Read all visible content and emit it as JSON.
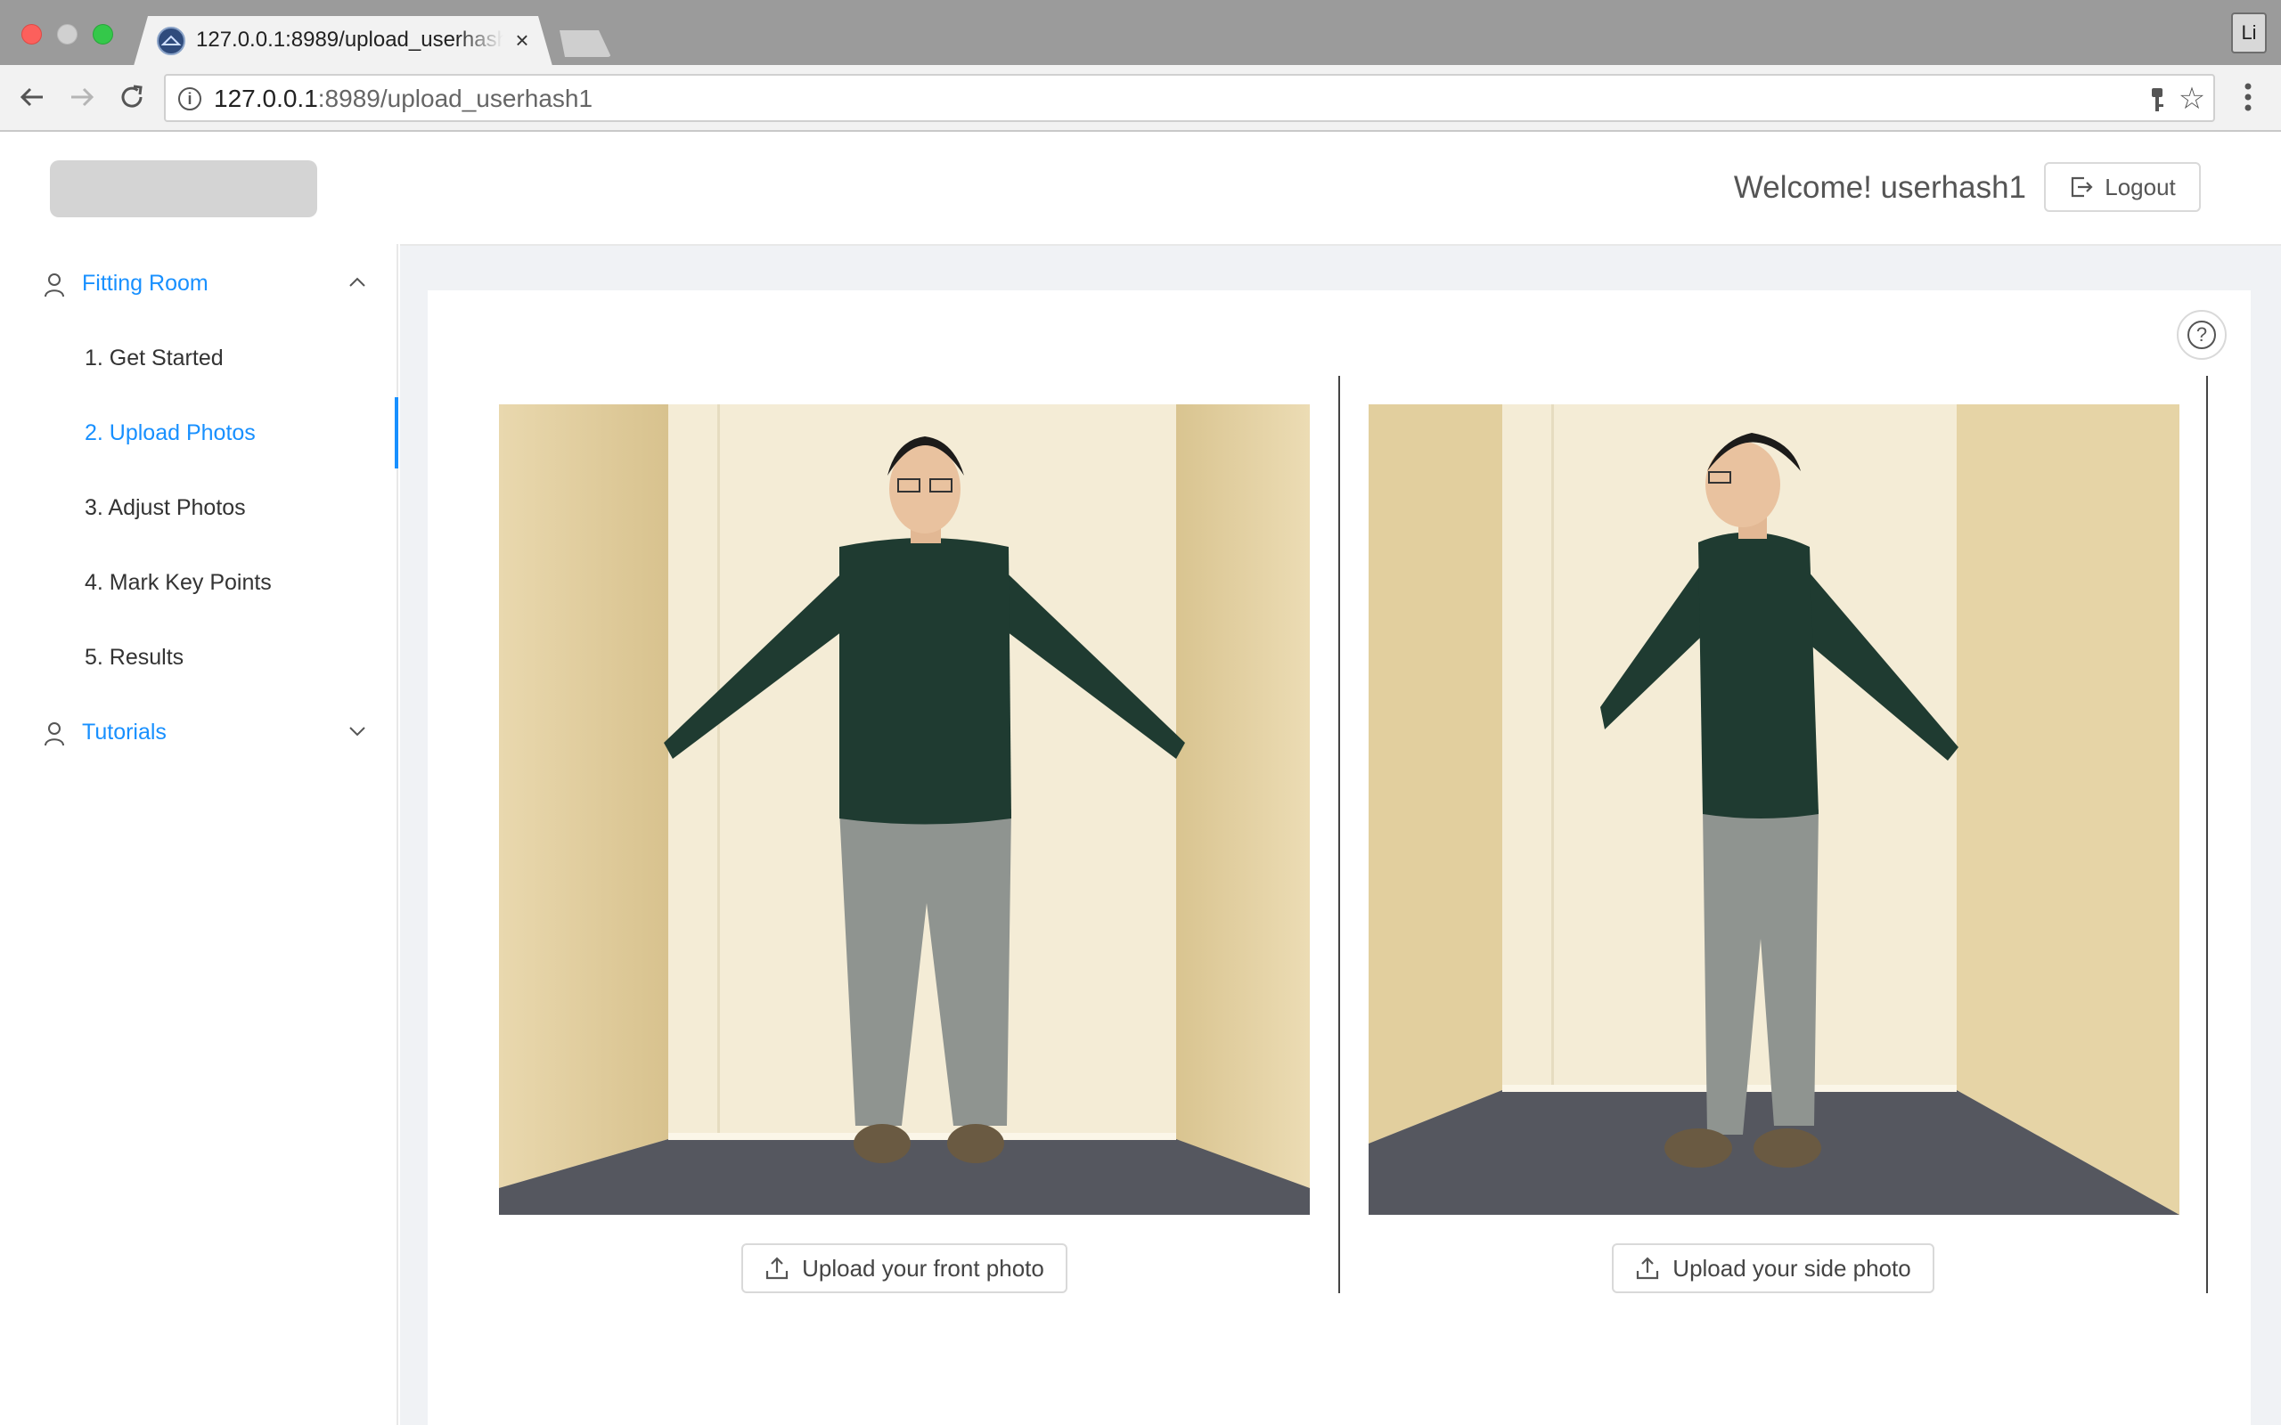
{
  "browser": {
    "tab_title": "127.0.0.1:8989/upload_userhash1",
    "tab_close": "×",
    "profile_initial": "Li",
    "url_host": "127.0.0.1",
    "url_rest": ":8989/upload_userhash1",
    "info_icon_glyph": "i",
    "star_glyph": "☆"
  },
  "header": {
    "welcome_text": "Welcome! userhash1",
    "logout_label": "Logout"
  },
  "sidebar": {
    "groups": [
      {
        "label": "Fitting Room",
        "expanded": true,
        "items": [
          {
            "label": "1. Get Started",
            "active": false
          },
          {
            "label": "2. Upload Photos",
            "active": true
          },
          {
            "label": "3. Adjust Photos",
            "active": false
          },
          {
            "label": "4. Mark Key Points",
            "active": false
          },
          {
            "label": "5. Results",
            "active": false
          }
        ]
      },
      {
        "label": "Tutorials",
        "expanded": false,
        "items": []
      }
    ]
  },
  "main": {
    "help_glyph": "?",
    "upload_front_label": "Upload your front photo",
    "upload_side_label": "Upload your side photo"
  },
  "colors": {
    "accent": "#1890ff",
    "sweater": "#1f3b31",
    "pants": "#8f9490",
    "wall": "#f1e6c8",
    "floor": "#54565e"
  }
}
